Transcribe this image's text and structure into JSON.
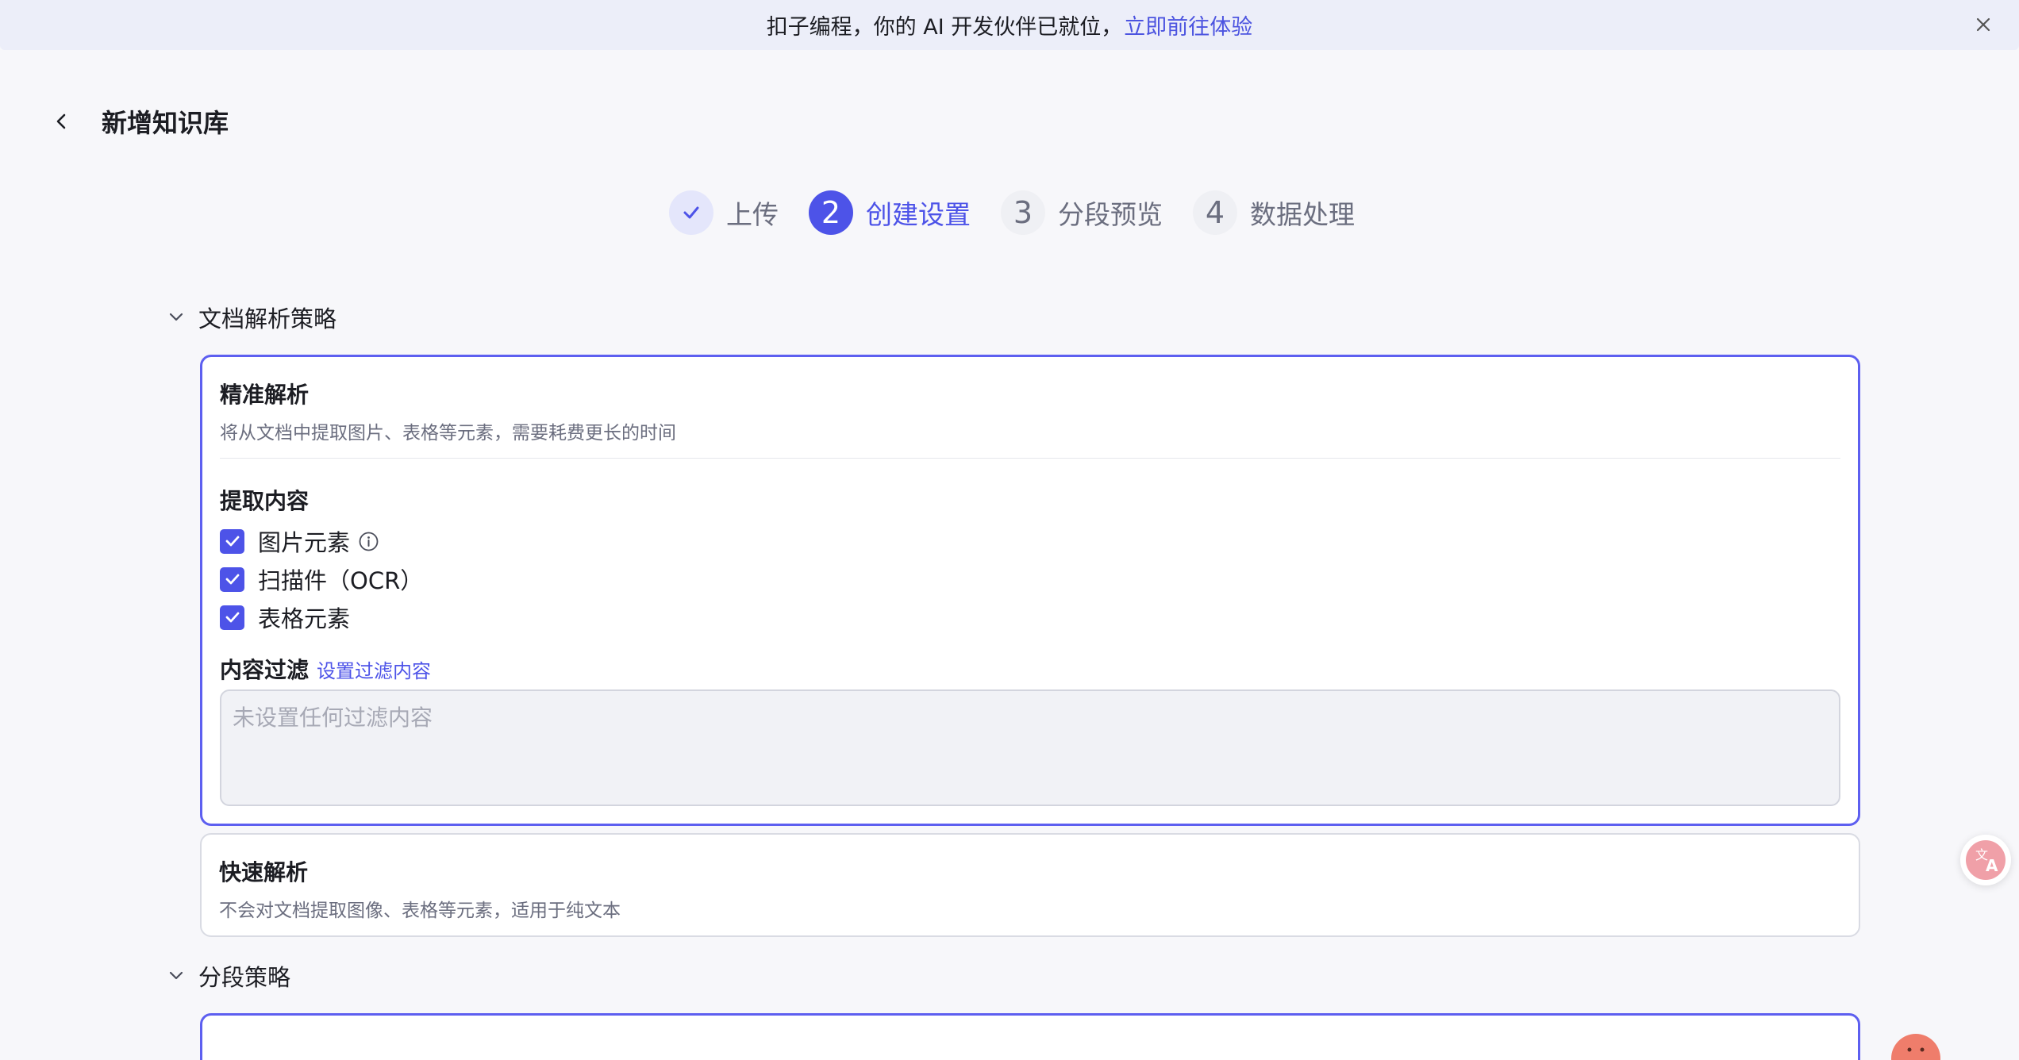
{
  "banner": {
    "text": "扣子编程，你的 AI 开发伙伴已就位，",
    "link": "立即前往体验"
  },
  "header": {
    "title": "新增知识库"
  },
  "steps": [
    {
      "number": "✓",
      "label": "上传",
      "state": "done"
    },
    {
      "number": "2",
      "label": "创建设置",
      "state": "active"
    },
    {
      "number": "3",
      "label": "分段预览",
      "state": "pending"
    },
    {
      "number": "4",
      "label": "数据处理",
      "state": "pending"
    }
  ],
  "parse_section": {
    "title": "文档解析策略",
    "precise": {
      "title": "精准解析",
      "desc": "将从文档中提取图片、表格等元素，需要耗费更长的时间",
      "extract_title": "提取内容",
      "options": [
        {
          "label": "图片元素",
          "checked": true
        },
        {
          "label": "扫描件（OCR）",
          "checked": true
        },
        {
          "label": "表格元素",
          "checked": true
        }
      ],
      "filter_label": "内容过滤",
      "filter_link": "设置过滤内容",
      "filter_placeholder": "未设置任何过滤内容"
    },
    "fast": {
      "title": "快速解析",
      "desc": "不会对文档提取图像、表格等元素，适用于纯文本"
    }
  },
  "segment_section": {
    "title": "分段策略"
  },
  "colors": {
    "accent": "#4d53e8",
    "banner_bg": "#eceef9",
    "page_bg": "#f7f7fa"
  }
}
